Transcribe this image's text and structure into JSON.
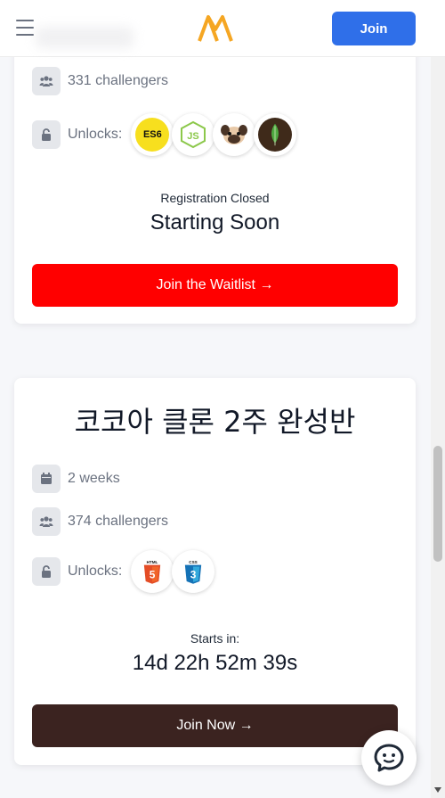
{
  "header": {
    "join_label": "Join"
  },
  "cards": [
    {
      "challengers": "331 challengers",
      "unlocks_label": "Unlocks:",
      "badges": [
        "es6-icon",
        "nodejs-icon",
        "pug-icon",
        "mongodb-icon"
      ],
      "status_label": "Registration Closed",
      "status_value": "Starting Soon",
      "cta_label": "Join the Waitlist →",
      "cta_color": "#ff0000"
    },
    {
      "title": "코코아 클론 2주 완성반",
      "duration": "2 weeks",
      "challengers": "374 challengers",
      "unlocks_label": "Unlocks:",
      "badges": [
        "html5-icon",
        "css3-icon"
      ],
      "status_label": "Starts in:",
      "status_value": "14d 22h 52m 39s",
      "cta_label": "Join Now →",
      "cta_color": "#3b2320"
    }
  ],
  "colors": {
    "accent_blue": "#2f6fe9",
    "logo_orange": "#f5a623"
  }
}
